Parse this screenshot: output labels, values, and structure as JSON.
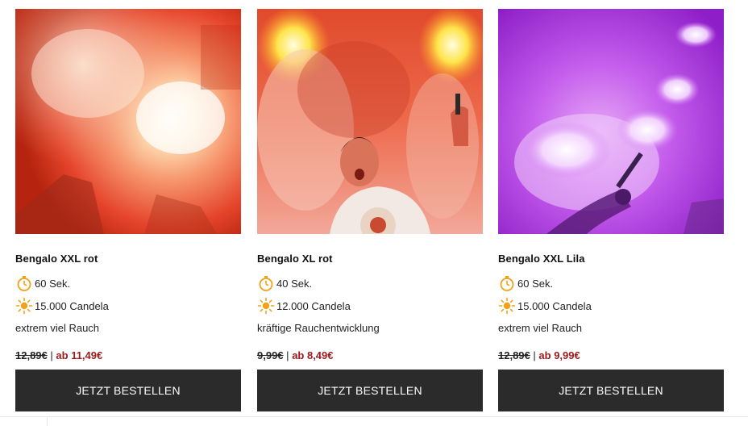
{
  "products": [
    {
      "title": "Bengalo XXL rot",
      "duration": "60 Sek.",
      "brightness": "15.000 Candela",
      "smoke": "extrem viel Rauch",
      "old_price": "12,89€",
      "separator": "|",
      "new_price": "ab 11,49€",
      "button_label": "JETZT BESTELLEN",
      "image_color": "#e8441e"
    },
    {
      "title": "Bengalo XL rot",
      "duration": "40 Sek.",
      "brightness": "12.000 Candela",
      "smoke": "kräftige Rauchentwicklung",
      "old_price": "9,99€",
      "separator": "|",
      "new_price": "ab 8,49€",
      "button_label": "JETZT BESTELLEN",
      "image_color": "#ea4d2d"
    },
    {
      "title": "Bengalo XXL Lila",
      "duration": "60 Sek.",
      "brightness": "15.000 Candela",
      "smoke": "extrem viel Rauch",
      "old_price": "12,89€",
      "separator": "|",
      "new_price": "ab 9,99€",
      "button_label": "JETZT BESTELLEN",
      "image_color": "#b13ee0"
    }
  ],
  "icons": {
    "duration": "stopwatch-icon",
    "brightness": "sun-icon"
  },
  "colors": {
    "button_bg": "#2b2b2b",
    "sale_price": "#9b1a1a",
    "icon_orange": "#f2a21a"
  }
}
